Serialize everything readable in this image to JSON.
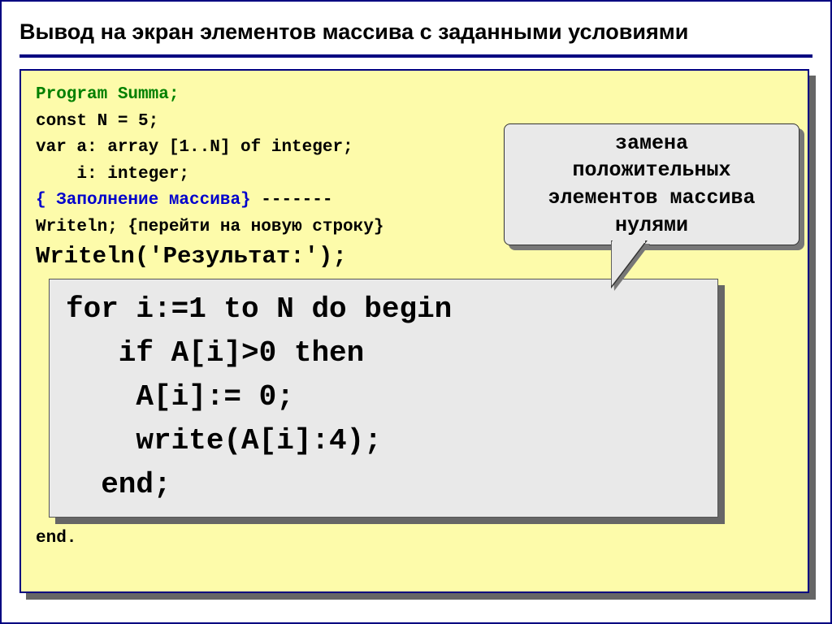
{
  "title": "Вывод на экран элементов массива с заданными условиями",
  "code": {
    "l1": "Program Summa;",
    "l2": "const N = 5;",
    "l3": "var a: array [1..N] of integer;",
    "l4": "    i: integer;",
    "l5a": "{ Заполнение массива}",
    "l5b": " -------",
    "l6": "Writeln; {перейти на новую строку}",
    "l7": "Writeln('Результат:');",
    "l8": "for i:=1 to N do begin",
    "l9": "   if A[i]>0 then",
    "l10": "    A[i]:= 0;",
    "l11": "    write(A[i]:4);",
    "l12": "  end;",
    "l13": "end."
  },
  "callout": {
    "line1": "замена",
    "line2": "положительных",
    "line3": "элементов массива",
    "line4": "нулями"
  }
}
